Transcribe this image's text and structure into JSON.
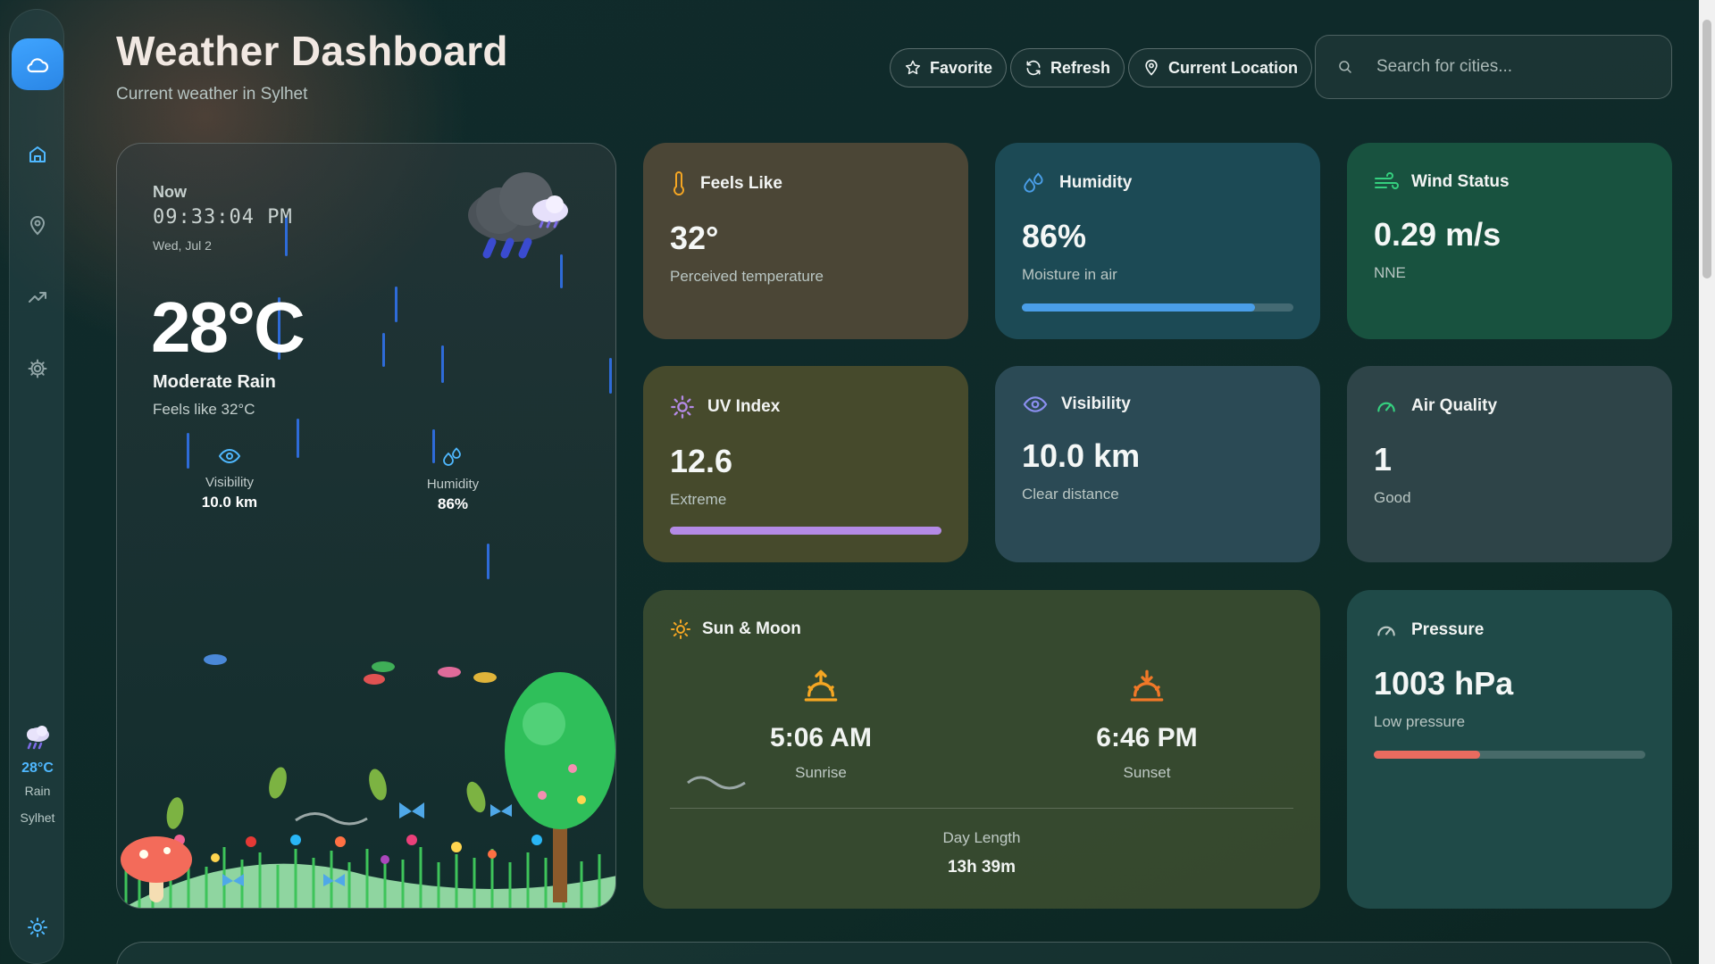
{
  "header": {
    "title": "Weather Dashboard",
    "subtitle": "Current weather in Sylhet",
    "buttons": {
      "favorite": "Favorite",
      "refresh": "Refresh",
      "location": "Current Location"
    },
    "search_placeholder": "Search for cities..."
  },
  "sidebar": {
    "nav_icons": [
      "home-icon",
      "map-pin-icon",
      "trending-icon",
      "settings-icon"
    ],
    "weather": {
      "temp": "28°C",
      "condition": "Rain",
      "city": "Sylhet"
    }
  },
  "hero": {
    "now_label": "Now",
    "time": "09:33:04 PM",
    "date": "Wed, Jul 2",
    "temperature": "28°C",
    "condition": "Moderate Rain",
    "feels_like": "Feels like 32°C",
    "visibility": {
      "label": "Visibility",
      "value": "10.0 km"
    },
    "humidity": {
      "label": "Humidity",
      "value": "86%"
    }
  },
  "cards": {
    "feels_like": {
      "title": "Feels Like",
      "value": "32°",
      "sub": "Perceived temperature",
      "color": "#4b4636"
    },
    "humidity": {
      "title": "Humidity",
      "value": "86%",
      "sub": "Moisture in air",
      "level": 0.86,
      "color": "#1c4a55"
    },
    "wind": {
      "title": "Wind Status",
      "value": "0.29 m/s",
      "sub": "NNE",
      "color": "#18523f"
    },
    "uv": {
      "title": "UV Index",
      "value": "12.6",
      "sub": "Extreme",
      "level": 1.0,
      "color": "#464a2c"
    },
    "visibility": {
      "title": "Visibility",
      "value": "10.0 km",
      "sub": "Clear distance",
      "color": "#2b4a55"
    },
    "air_quality": {
      "title": "Air Quality",
      "value": "1",
      "sub": "Good",
      "color": "#2e4448"
    },
    "pressure": {
      "title": "Pressure",
      "value": "1003 hPa",
      "sub": "Low pressure",
      "level": 0.39,
      "color": "#1f4a48"
    }
  },
  "sun_moon": {
    "title": "Sun & Moon",
    "sunrise": {
      "time": "5:06 AM",
      "label": "Sunrise"
    },
    "sunset": {
      "time": "6:46 PM",
      "label": "Sunset"
    },
    "day_length": {
      "label": "Day Length",
      "value": "13h 39m"
    }
  },
  "colors": {
    "accent_blue": "#4fb8ff",
    "humidity_bar": "#4a9ee8",
    "uv_bar": "#b48ae6",
    "pressure_bar": "#e86b5f",
    "sun_orange": "#f5a623"
  }
}
